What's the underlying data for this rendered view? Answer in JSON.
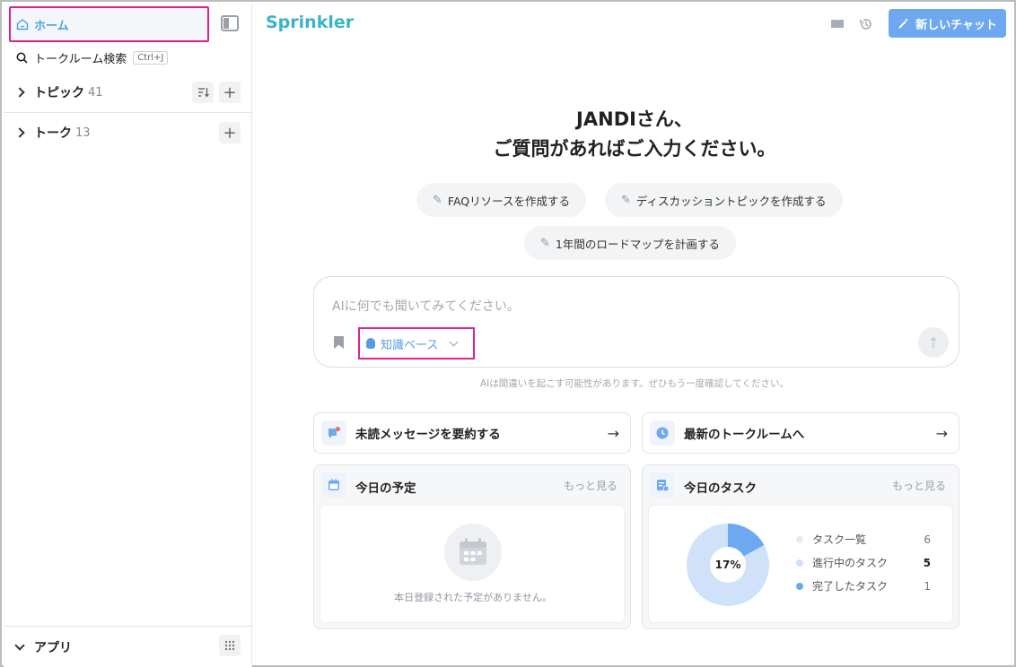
{
  "sidebar": {
    "home_label": "ホーム",
    "search_label": "トークルーム検索",
    "search_shortcut": "Ctrl+J",
    "topics": {
      "label": "トピック",
      "count": "41"
    },
    "talks": {
      "label": "トーク",
      "count": "13"
    },
    "apps_label": "アプリ"
  },
  "header": {
    "brand": "Sprinkler",
    "new_chat_label": "新しいチャット"
  },
  "greeting": {
    "line1": "JANDIさん、",
    "line2": "ご質問があればご入力ください。"
  },
  "suggestions": [
    "FAQリソースを作成する",
    "ディスカッショントピックを作成する",
    "1年間のロードマップを計画する"
  ],
  "ai_input": {
    "placeholder": "AIに何でも聞いてみてください。",
    "knowledge_base_label": "知識ベース"
  },
  "disclaimer": "AIは間違いを起こす可能性があります。ぜひもう一度確認してください。",
  "quick_actions": [
    {
      "label": "未読メッセージを要約する"
    },
    {
      "label": "最新のトークルームへ"
    }
  ],
  "schedule_card": {
    "title": "今日の予定",
    "more_label": "もっと見る",
    "empty_text": "本日登録された予定がありません。"
  },
  "tasks_card": {
    "title": "今日のタスク",
    "more_label": "もっと見る",
    "center_label": "17%",
    "completed_fraction": 0.17,
    "legend": [
      {
        "label": "タスク一覧",
        "value": "6",
        "color": "#e9ebee"
      },
      {
        "label": "進行中のタスク",
        "value": "5",
        "color": "#cfe2f9"
      },
      {
        "label": "完了したタスク",
        "value": "1",
        "color": "#6ea8f0"
      }
    ]
  },
  "colors": {
    "accent": "#6ea8f0",
    "brand": "#3ab3c9",
    "highlight": "#e0218a"
  }
}
